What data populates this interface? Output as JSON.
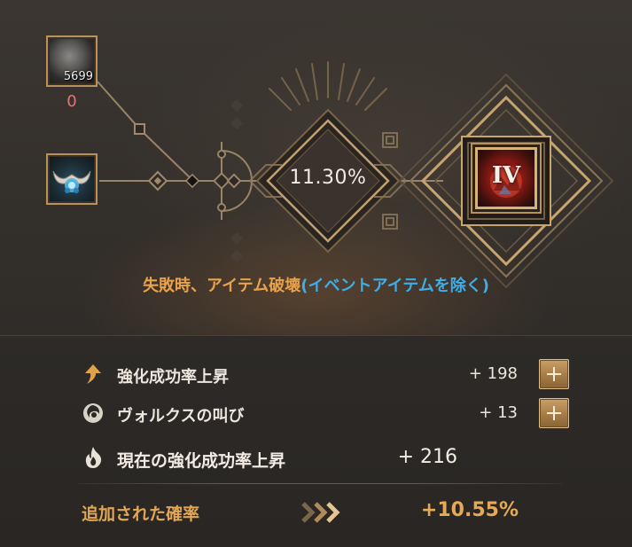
{
  "materials": {
    "stone": {
      "count": "5699",
      "owned": "0",
      "icon": "gray-stone-icon"
    },
    "horn": {
      "icon": "blue-horned-crystal-icon"
    }
  },
  "result": {
    "success_rate": "11.30%",
    "tier": "IV",
    "icon": "red-crystal-item-icon"
  },
  "warning": {
    "part1": "失敗時、アイテム破壊",
    "part2": "(イベントアイテムを除く)"
  },
  "stats": {
    "rows": [
      {
        "label": "強化成功率上昇",
        "value": "+ 198",
        "icon": "up-arrow-icon"
      },
      {
        "label": "ヴォルクスの叫び",
        "value": "+ 13",
        "icon": "vortex-emblem-icon"
      },
      {
        "label": "現在の強化成功率上昇",
        "value": "+ 216",
        "icon": "flame-icon"
      }
    ],
    "added_label": "追加された確率",
    "added_value": "+10.55%"
  },
  "colors": {
    "accent_gold": "#b8925a",
    "warning_orange": "#e8a24c",
    "warning_blue": "#3eaee8",
    "stone_owned_red": "#e8727a",
    "added_value": "#e6a955"
  }
}
